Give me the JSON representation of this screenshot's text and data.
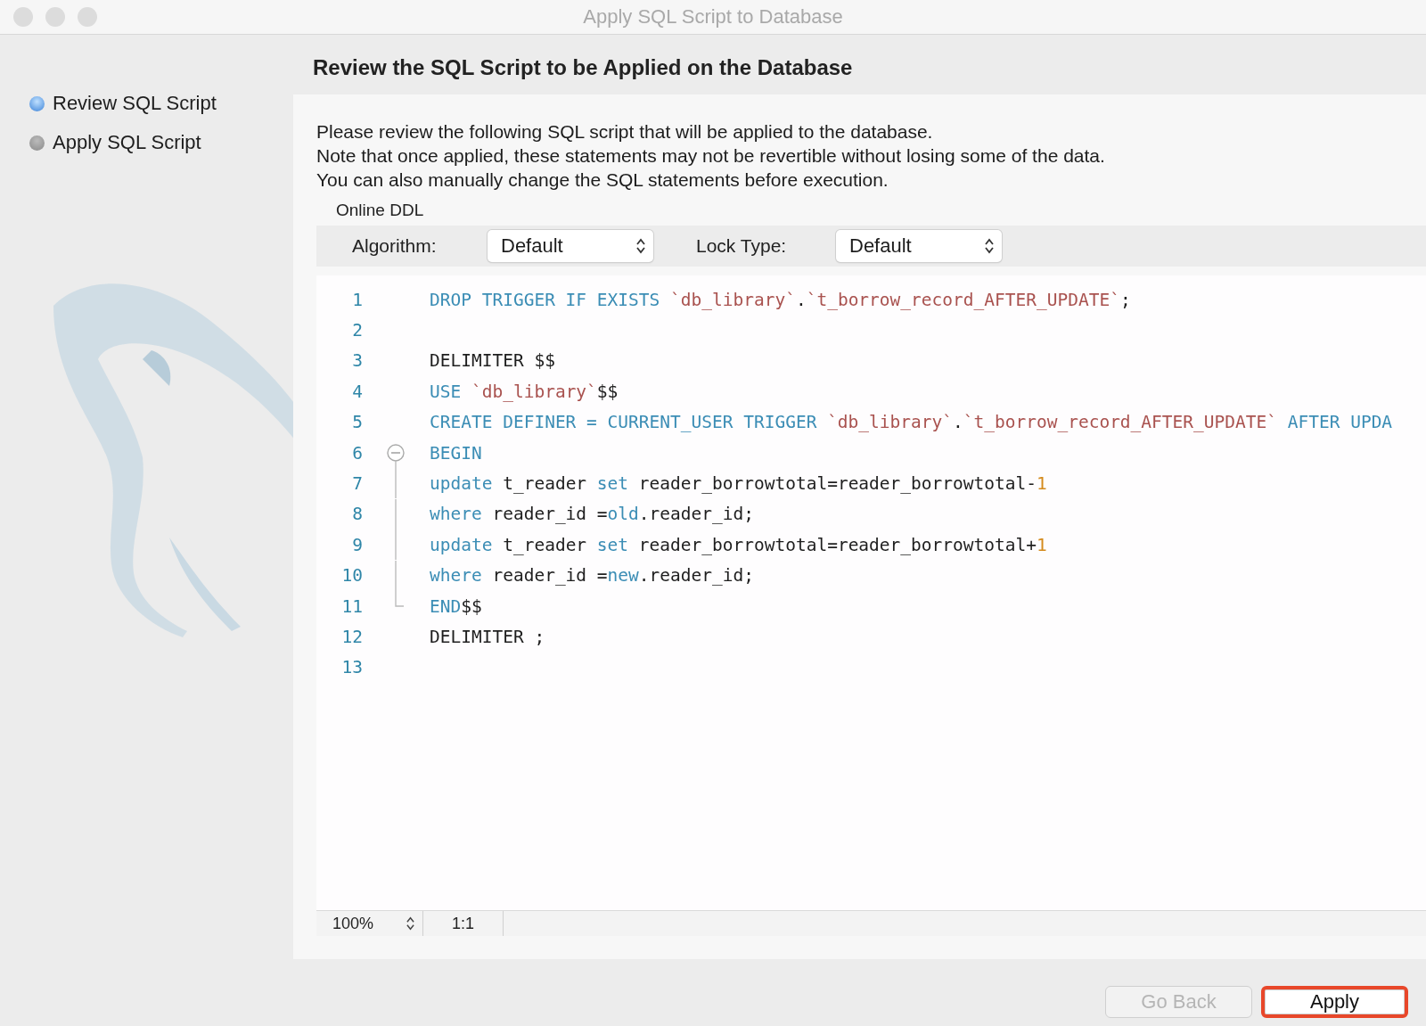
{
  "window": {
    "title": "Apply SQL Script to Database"
  },
  "steps": [
    {
      "label": "Review SQL Script",
      "selected": true
    },
    {
      "label": "Apply SQL Script",
      "selected": false
    }
  ],
  "heading": "Review the SQL Script to be Applied on the Database",
  "intro": [
    "Please review the following SQL script that will be applied to the database.",
    "Note that once applied, these statements may not be revertible without losing some of the data.",
    "You can also manually change the SQL statements before execution."
  ],
  "online_ddl": {
    "title": "Online DDL",
    "algorithm": {
      "label": "Algorithm:",
      "value": "Default"
    },
    "lock_type": {
      "label": "Lock Type:",
      "value": "Default"
    }
  },
  "code": [
    {
      "number": "1",
      "kind": "plain",
      "tokens": [
        {
          "kind": "kw",
          "text": "DROP TRIGGER IF EXISTS "
        },
        {
          "kind": "str",
          "text": "`db_library`"
        },
        {
          "kind": "plain",
          "text": "."
        },
        {
          "kind": "str",
          "text": "`t_borrow_record_AFTER_UPDATE`"
        },
        {
          "kind": "plain",
          "text": ";"
        }
      ]
    },
    {
      "number": "2",
      "kind": "plain"
    },
    {
      "number": "3",
      "kind": "plain",
      "tokens": [
        {
          "kind": "plain",
          "text": "DELIMITER $$"
        }
      ]
    },
    {
      "number": "4",
      "kind": "plain",
      "tokens": [
        {
          "kind": "kw",
          "text": "USE "
        },
        {
          "kind": "str",
          "text": "`db_library`"
        },
        {
          "kind": "plain",
          "text": "$$"
        }
      ]
    },
    {
      "number": "5",
      "kind": "plain",
      "tokens": [
        {
          "kind": "kw",
          "text": "CREATE DEFINER = CURRENT_USER TRIGGER "
        },
        {
          "kind": "str",
          "text": "`db_library`"
        },
        {
          "kind": "plain",
          "text": "."
        },
        {
          "kind": "str",
          "text": "`t_borrow_record_AFTER_UPDATE`"
        },
        {
          "kind": "kw",
          "text": " AFTER UPDA"
        }
      ]
    },
    {
      "number": "6",
      "kind": "fold_start",
      "tokens": [
        {
          "kind": "kw",
          "text": "BEGIN"
        }
      ]
    },
    {
      "number": "7",
      "kind": "fold_body",
      "tokens": [
        {
          "kind": "kw",
          "text": "update"
        },
        {
          "kind": "plain",
          "text": " t_reader "
        },
        {
          "kind": "kw",
          "text": "set"
        },
        {
          "kind": "plain",
          "text": " reader_borrowtotal=reader_borrowtotal-"
        },
        {
          "kind": "num",
          "text": "1"
        }
      ]
    },
    {
      "number": "8",
      "kind": "fold_body",
      "tokens": [
        {
          "kind": "kw",
          "text": "where"
        },
        {
          "kind": "plain",
          "text": " reader_id ="
        },
        {
          "kind": "kw",
          "text": "old"
        },
        {
          "kind": "plain",
          "text": ".reader_id;"
        }
      ]
    },
    {
      "number": "9",
      "kind": "fold_body",
      "tokens": [
        {
          "kind": "kw",
          "text": "update"
        },
        {
          "kind": "plain",
          "text": " t_reader "
        },
        {
          "kind": "kw",
          "text": "set"
        },
        {
          "kind": "plain",
          "text": " reader_borrowtotal=reader_borrowtotal+"
        },
        {
          "kind": "num",
          "text": "1"
        }
      ]
    },
    {
      "number": "10",
      "kind": "fold_body",
      "tokens": [
        {
          "kind": "kw",
          "text": "where"
        },
        {
          "kind": "plain",
          "text": " reader_id ="
        },
        {
          "kind": "kw",
          "text": "new"
        },
        {
          "kind": "plain",
          "text": ".reader_id;"
        }
      ]
    },
    {
      "number": "11",
      "kind": "fold_end",
      "tokens": [
        {
          "kind": "kw",
          "text": "END"
        },
        {
          "kind": "plain",
          "text": "$$"
        }
      ]
    },
    {
      "number": "12",
      "kind": "plain",
      "tokens": [
        {
          "kind": "plain",
          "text": "DELIMITER ;"
        }
      ]
    },
    {
      "number": "13",
      "kind": "plain"
    }
  ],
  "status_bar": {
    "zoom": "100%",
    "position": "1:1"
  },
  "buttons": [
    {
      "label": "Go Back",
      "disabled": true,
      "highlighted": false
    },
    {
      "label": "Apply",
      "disabled": false,
      "highlighted": true
    }
  ]
}
